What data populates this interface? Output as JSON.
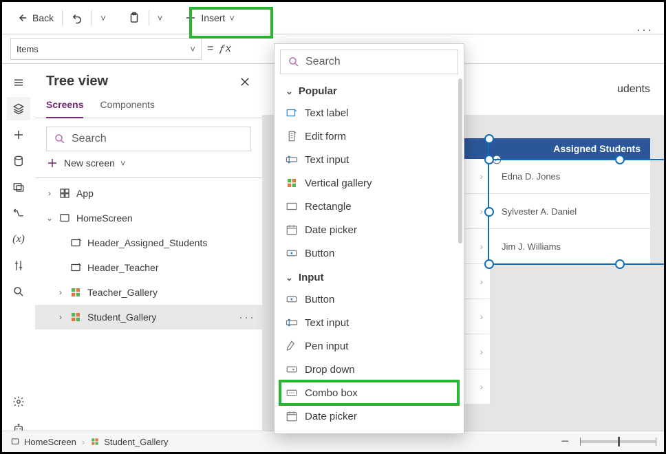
{
  "cmdbar": {
    "back": "Back",
    "insert": "Insert"
  },
  "formula": {
    "property": "Items",
    "eq": "=",
    "fx": "ƒx"
  },
  "tree": {
    "title": "Tree view",
    "tabs": {
      "screens": "Screens",
      "components": "Components"
    },
    "search_ph": "Search",
    "new_screen": "New screen",
    "items": {
      "app": "App",
      "home": "HomeScreen",
      "hdr_students": "Header_Assigned_Students",
      "hdr_teacher": "Header_Teacher",
      "teacher_gal": "Teacher_Gallery",
      "student_gal": "Student_Gallery"
    }
  },
  "canvas": {
    "page_title_suffix": "udents",
    "gallery_header": "Assigned Students",
    "rows": [
      "Edna D. Jones",
      "Sylvester A. Daniel",
      "Jim J. Williams"
    ]
  },
  "dropdown": {
    "search_ph": "Search",
    "sections": {
      "popular": "Popular",
      "input": "Input"
    },
    "items": {
      "text_label": "Text label",
      "edit_form": "Edit form",
      "text_input": "Text input",
      "vertical_gallery": "Vertical gallery",
      "rectangle": "Rectangle",
      "date_picker": "Date picker",
      "button": "Button",
      "pen_input": "Pen input",
      "drop_down": "Drop down",
      "combo_box": "Combo box"
    }
  },
  "crumb": {
    "home": "HomeScreen",
    "gal": "Student_Gallery"
  }
}
